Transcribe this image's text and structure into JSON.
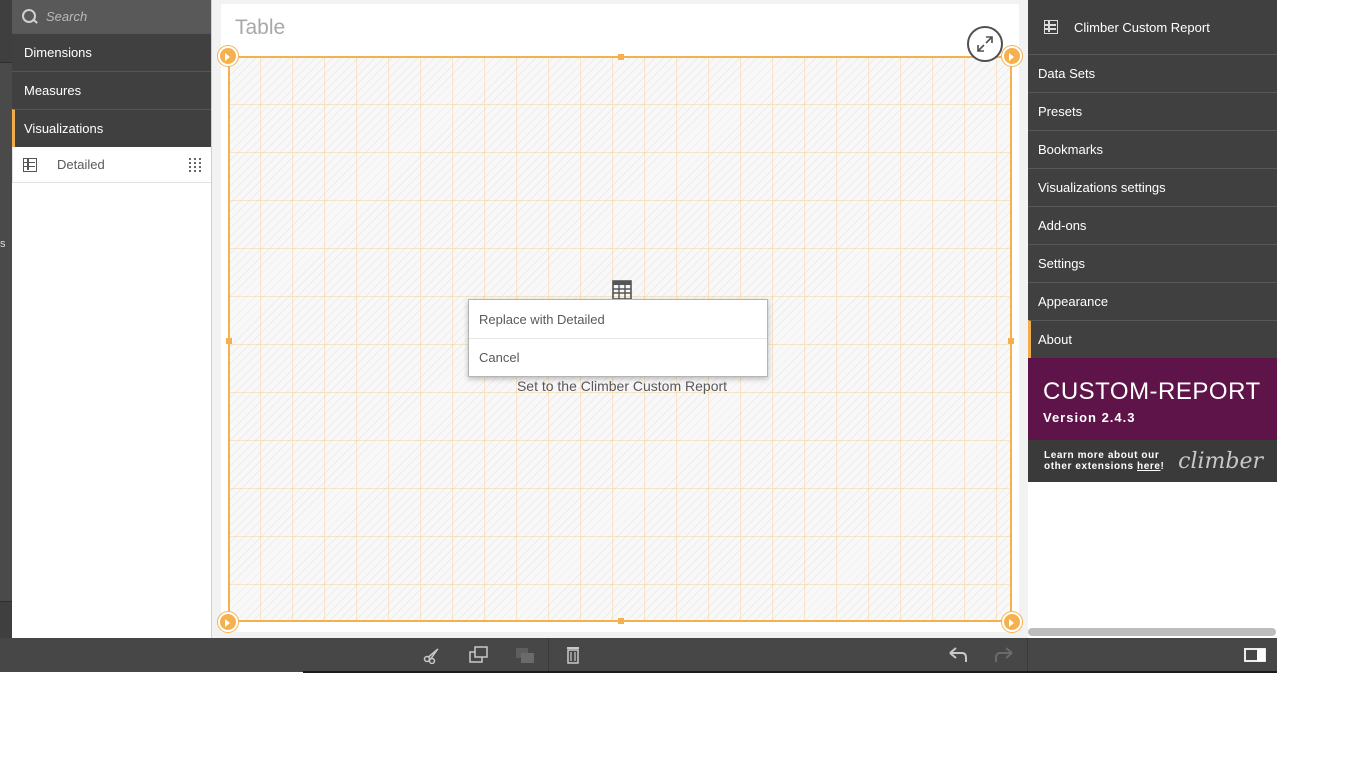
{
  "left_panel": {
    "search_placeholder": "Search",
    "sections": [
      {
        "label": "Dimensions"
      },
      {
        "label": "Measures"
      },
      {
        "label": "Visualizations"
      }
    ],
    "visualization_items": [
      {
        "label": "Detailed",
        "icon": "table-icon"
      }
    ],
    "far_left_stub": "s"
  },
  "canvas": {
    "object_title": "Table",
    "placeholder_text": "Set to the Climber Custom Report",
    "context_menu": [
      {
        "label": "Replace with Detailed"
      },
      {
        "label": "Cancel"
      }
    ]
  },
  "right_panel": {
    "header": "Climber Custom Report",
    "items": [
      {
        "label": "Data Sets"
      },
      {
        "label": "Presets"
      },
      {
        "label": "Bookmarks"
      },
      {
        "label": "Visualizations settings"
      },
      {
        "label": "Add-ons"
      },
      {
        "label": "Settings"
      },
      {
        "label": "Appearance"
      },
      {
        "label": "About"
      }
    ],
    "promo": {
      "title": "CUSTOM-REPORT",
      "version": "Version 2.4.3",
      "learn_line1": "Learn more about our",
      "learn_line2_prefix": "other extensions ",
      "learn_link": "here",
      "learn_suffix": "!",
      "brand": "climber"
    }
  },
  "toolbar": {
    "icons": [
      "scissors-icon",
      "duplicate-icon",
      "copy-icon",
      "delete-icon",
      "undo-icon",
      "redo-icon",
      "toggle-panel-icon"
    ]
  },
  "colors": {
    "accent": "#f5b14f",
    "panel_dark": "#404040",
    "promo": "#5e1448"
  }
}
